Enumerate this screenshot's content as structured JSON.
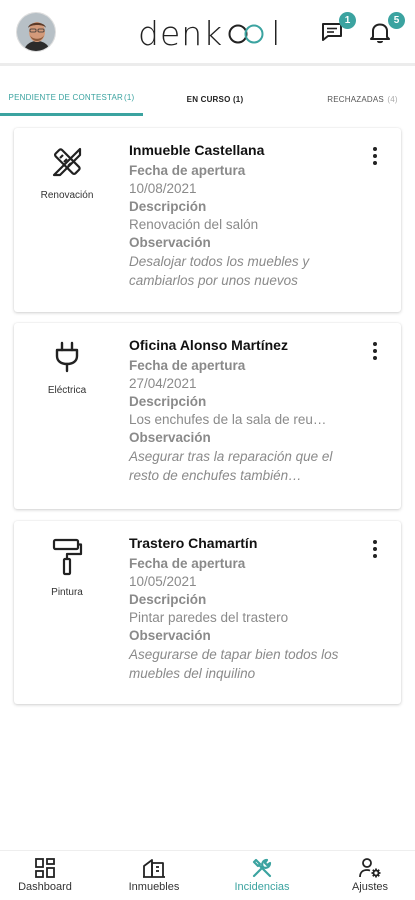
{
  "header": {
    "logo": {
      "prefix": "denk",
      "suffix": "l"
    },
    "messages_badge": "1",
    "notifications_badge": "5"
  },
  "tabs": [
    {
      "label": "PENDIENTE DE CONTESTAR",
      "count": "(1)"
    },
    {
      "label": "EN CURSO",
      "count": "(1)"
    },
    {
      "label": "RECHAZADAS",
      "count": "(4)"
    }
  ],
  "cards": [
    {
      "category": "Renovación",
      "category_icon": "tools-icon",
      "title": "Inmueble Castellana",
      "date_label": "Fecha de apertura",
      "date": "10/08/2021",
      "desc_label": "Descripción",
      "desc": "Renovación del salón",
      "obs_label": "Observación",
      "obs": "Desalojar todos los muebles y cambiarlos por unos nuevos"
    },
    {
      "category": "Eléctrica",
      "category_icon": "plug-icon",
      "title": "Oficina Alonso Martínez",
      "date_label": "Fecha de apertura",
      "date": "27/04/2021",
      "desc_label": "Descripción",
      "desc": "Los enchufes de la sala de reu…",
      "obs_label": "Observación",
      "obs": "Asegurar tras la reparación que el resto de enchufes también…"
    },
    {
      "category": "Pintura",
      "category_icon": "paint-roller-icon",
      "title": "Trastero Chamartín",
      "date_label": "Fecha de apertura",
      "date": "10/05/2021",
      "desc_label": "Descripción",
      "desc": "Pintar paredes del trastero",
      "obs_label": "Observación",
      "obs": "Asegurarse de tapar bien todos los muebles del inquilino"
    }
  ],
  "nav": [
    {
      "label": "Dashboard",
      "icon": "dashboard-icon"
    },
    {
      "label": "Inmuebles",
      "icon": "building-icon"
    },
    {
      "label": "Incidencias",
      "icon": "tools-icon",
      "active": true
    },
    {
      "label": "Ajustes",
      "icon": "user-settings-icon"
    }
  ],
  "colors": {
    "accent": "#3ba3a0",
    "muted": "#8a8a8a"
  }
}
